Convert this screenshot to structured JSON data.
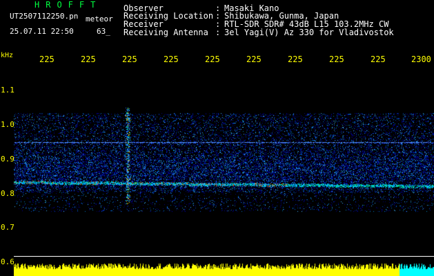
{
  "header": {
    "title": "HROFFT",
    "filename": "UT2507112250.pn",
    "filename_suffix": "meteor",
    "datetime": "25.07.11 22:50",
    "count": "63_"
  },
  "info": [
    {
      "label": "Observer",
      "value": "Masaki Kano"
    },
    {
      "label": "Receiving Location",
      "value": "Shibukawa, Gunma, Japan"
    },
    {
      "label": "Receiver",
      "value": "RTL-SDR SDR# 43dB L15 103.2MHz CW"
    },
    {
      "label": "Receiving Antenna",
      "value": "3el Yagi(V) Az 330 for Vladivostok"
    }
  ],
  "colon": ":",
  "axes": {
    "y_unit": "kHz",
    "y_ticks": [
      "1.1",
      "1.0",
      "0.9",
      "0.8",
      "0.7",
      "0.6"
    ],
    "x_ticks": [
      "225",
      "225",
      "225",
      "225",
      "225",
      "225",
      "225",
      "225",
      "225",
      "2300"
    ]
  },
  "colors": {
    "header_title": "#00ff40",
    "axis_labels": "#ffff00",
    "text": "#ffffff",
    "meter_bar": "#ffff00",
    "meter_right": "#00ffff"
  }
}
